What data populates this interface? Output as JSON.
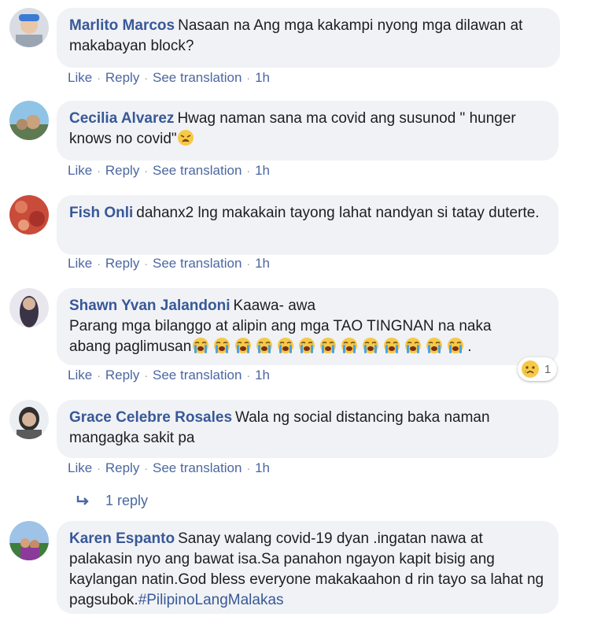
{
  "comments": [
    {
      "author": "Marlito Marcos",
      "text": "Nasaan na Ang mga kakampi nyong mga dilawan at makabayan block?",
      "actions": [
        "Like",
        "Reply",
        "See translation"
      ],
      "time": "1h"
    },
    {
      "author": "Cecilia Alvarez",
      "text": "Hwag naman sana ma covid ang susunod \" hunger knows no covid\"",
      "emoji_suffix": "weary-face-emoji",
      "actions": [
        "Like",
        "Reply",
        "See translation"
      ],
      "time": "1h"
    },
    {
      "author": "Fish Onli",
      "text": "dahanx2 lng makakain tayong lahat nandyan si tatay duterte.",
      "actions": [
        "Like",
        "Reply",
        "See translation"
      ],
      "time": "1h"
    },
    {
      "author": "Shawn Yvan Jalandoni",
      "text": "Kaawa- awa",
      "text_line2": "Parang mga bilanggo at alipin ang mga TAO TINGNAN na naka",
      "text_line3": "abang paglimusan",
      "crying_emoji_count": 13,
      "text_line3_end": ".",
      "reaction": {
        "icon": "sad-reaction-icon",
        "count": "1"
      },
      "actions": [
        "Like",
        "Reply",
        "See translation"
      ],
      "time": "1h"
    },
    {
      "author": "Grace Celebre Rosales",
      "text": "Wala ng social distancing baka naman mangagka sakit pa",
      "actions": [
        "Like",
        "Reply",
        "See translation"
      ],
      "time": "1h",
      "replies_label": "1 reply"
    },
    {
      "author": "Karen Espanto",
      "text": "Sanay walang covid-19 dyan .ingatan nawa at palakasin nyo ang bawat isa.Sa panahon ngayon kapit bisig ang kaylangan natin.God bless everyone makakaahon d rin tayo sa lahat ng pagsubok.",
      "hashtag": "#PilipinoLangMalakas"
    }
  ],
  "colors": {
    "link": "#385898",
    "action": "#4b67a1",
    "bubble": "#f0f2f5",
    "text": "#1c1e21"
  }
}
